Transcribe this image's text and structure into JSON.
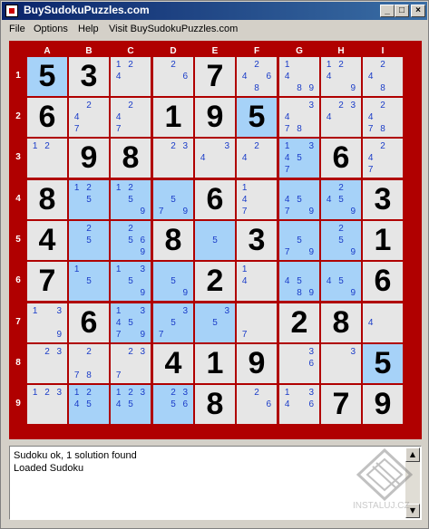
{
  "window": {
    "title": "BuySudokuPuzzles.com"
  },
  "title_buttons": {
    "minimize": "_",
    "maximize": "□",
    "close": "×"
  },
  "menu": [
    "File",
    "Options",
    "Help",
    "Visit BuySudokuPuzzles.com"
  ],
  "columns": [
    "A",
    "B",
    "C",
    "D",
    "E",
    "F",
    "G",
    "H",
    "I"
  ],
  "rows": [
    "1",
    "2",
    "3",
    "4",
    "5",
    "6",
    "7",
    "8",
    "9"
  ],
  "grid": [
    [
      {
        "v": "5",
        "hl": true
      },
      {
        "v": "3"
      },
      {
        "c": [
          "1",
          "2",
          "",
          "4"
        ]
      },
      {
        "c": [
          "",
          "2",
          "",
          "",
          "",
          "6"
        ]
      },
      {
        "v": "7"
      },
      {
        "c": [
          "",
          "2",
          "",
          "4",
          "",
          "6",
          "",
          "8"
        ]
      },
      {
        "c": [
          "1",
          "",
          "",
          "4",
          "",
          "",
          "",
          "8",
          "9"
        ]
      },
      {
        "c": [
          "1",
          "2",
          "",
          "4",
          "",
          "",
          "",
          "",
          "9"
        ]
      },
      {
        "c": [
          "",
          "2",
          "",
          "4",
          "",
          "",
          "",
          "8"
        ]
      }
    ],
    [
      {
        "v": "6"
      },
      {
        "c": [
          "",
          "2",
          "",
          "4",
          "",
          "",
          "7"
        ]
      },
      {
        "c": [
          "",
          "2",
          "",
          "4",
          "",
          "",
          "7"
        ]
      },
      {
        "v": "1"
      },
      {
        "v": "9"
      },
      {
        "v": "5",
        "hl": true
      },
      {
        "c": [
          "",
          "",
          "3",
          "4",
          "",
          "",
          "7",
          "8"
        ]
      },
      {
        "c": [
          "",
          "2",
          "3",
          "4"
        ]
      },
      {
        "c": [
          "",
          "2",
          "",
          "4",
          "",
          "",
          "7",
          "8"
        ]
      }
    ],
    [
      {
        "c": [
          "1",
          "2"
        ]
      },
      {
        "v": "9"
      },
      {
        "v": "8"
      },
      {
        "c": [
          "",
          "2",
          "3"
        ]
      },
      {
        "c": [
          "",
          "",
          "3",
          "4"
        ]
      },
      {
        "c": [
          "",
          "2",
          "",
          "4"
        ]
      },
      {
        "c": [
          "1",
          "",
          "3",
          "4",
          "5",
          "",
          "7"
        ],
        "hl": true
      },
      {
        "v": "6"
      },
      {
        "c": [
          "",
          "2",
          "",
          "4",
          "",
          "",
          "7"
        ]
      }
    ],
    [
      {
        "v": "8"
      },
      {
        "c": [
          "1",
          "2",
          "",
          "",
          "5"
        ],
        "hl": true
      },
      {
        "c": [
          "1",
          "2",
          "",
          "",
          "5",
          "",
          "",
          "",
          "9"
        ],
        "hl": true
      },
      {
        "c": [
          "",
          "",
          "",
          "",
          "5",
          "",
          "7",
          "",
          "9"
        ],
        "hl": true
      },
      {
        "v": "6"
      },
      {
        "c": [
          "1",
          "",
          "",
          "4",
          "",
          "",
          "7"
        ]
      },
      {
        "c": [
          "",
          "",
          "",
          "4",
          "5",
          "",
          "7",
          "",
          "9"
        ],
        "hl": true
      },
      {
        "c": [
          "",
          "2",
          "",
          "4",
          "5",
          "",
          "",
          "",
          "9"
        ],
        "hl": true
      },
      {
        "v": "3"
      }
    ],
    [
      {
        "v": "4"
      },
      {
        "c": [
          "",
          "2",
          "",
          "",
          "5"
        ],
        "hl": true
      },
      {
        "c": [
          "",
          "2",
          "",
          "",
          "5",
          "6",
          "",
          "",
          "9"
        ],
        "hl": true
      },
      {
        "v": "8"
      },
      {
        "c": [
          "",
          "",
          "",
          "",
          "5"
        ],
        "hl": true
      },
      {
        "v": "3"
      },
      {
        "c": [
          "",
          "",
          "",
          "",
          "5",
          "",
          "7",
          "",
          "9"
        ],
        "hl": true
      },
      {
        "c": [
          "",
          "2",
          "",
          "",
          "5",
          "",
          "",
          "",
          "9"
        ],
        "hl": true
      },
      {
        "v": "1"
      }
    ],
    [
      {
        "v": "7"
      },
      {
        "c": [
          "1",
          "",
          "",
          "",
          "5"
        ],
        "hl": true
      },
      {
        "c": [
          "1",
          "",
          "3",
          "",
          "5",
          "",
          "",
          "",
          "9"
        ],
        "hl": true
      },
      {
        "c": [
          "",
          "",
          "",
          "",
          "5",
          "",
          "",
          "",
          "9"
        ],
        "hl": true
      },
      {
        "v": "2"
      },
      {
        "c": [
          "1",
          "",
          "",
          "4"
        ]
      },
      {
        "c": [
          "",
          "",
          "",
          "4",
          "5",
          "",
          "",
          "8",
          "9"
        ],
        "hl": true
      },
      {
        "c": [
          "",
          "",
          "",
          "4",
          "5",
          "",
          "",
          "",
          "9"
        ],
        "hl": true
      },
      {
        "v": "6"
      }
    ],
    [
      {
        "c": [
          "1",
          "",
          "3",
          "",
          "",
          "",
          "",
          "",
          "9"
        ]
      },
      {
        "v": "6"
      },
      {
        "c": [
          "1",
          "",
          "3",
          "4",
          "5",
          "",
          "7",
          "",
          "9"
        ],
        "hl": true
      },
      {
        "c": [
          "",
          "",
          "3",
          "",
          "5",
          "",
          "7"
        ],
        "hl": true
      },
      {
        "c": [
          "",
          "",
          "3",
          "",
          "5"
        ],
        "hl": true
      },
      {
        "c": [
          "",
          "",
          "",
          "",
          "",
          "",
          "7"
        ]
      },
      {
        "v": "2"
      },
      {
        "v": "8"
      },
      {
        "c": [
          "",
          "",
          "",
          "4"
        ]
      }
    ],
    [
      {
        "c": [
          "",
          "2",
          "3"
        ]
      },
      {
        "c": [
          "",
          "2",
          "",
          "",
          "",
          "",
          "7",
          "8"
        ]
      },
      {
        "c": [
          "",
          "2",
          "3",
          "",
          "",
          "",
          "7"
        ]
      },
      {
        "v": "4"
      },
      {
        "v": "1"
      },
      {
        "v": "9"
      },
      {
        "c": [
          "",
          "",
          "3",
          "",
          "",
          "6"
        ]
      },
      {
        "c": [
          "",
          "",
          "3"
        ]
      },
      {
        "v": "5",
        "hl": true
      }
    ],
    [
      {
        "c": [
          "1",
          "2",
          "3"
        ]
      },
      {
        "c": [
          "1",
          "2",
          "",
          "4",
          "5"
        ],
        "hl": true
      },
      {
        "c": [
          "1",
          "2",
          "3",
          "4",
          "5"
        ],
        "hl": true
      },
      {
        "c": [
          "",
          "2",
          "3",
          "",
          "5",
          "6"
        ],
        "hl": true
      },
      {
        "v": "8"
      },
      {
        "c": [
          "",
          "2",
          "",
          "",
          "",
          "6"
        ]
      },
      {
        "c": [
          "1",
          "",
          "3",
          "4",
          "",
          "6"
        ]
      },
      {
        "v": "7"
      },
      {
        "v": "9"
      }
    ]
  ],
  "log": [
    "Sudoku ok, 1 solution found",
    "Loaded Sudoku"
  ],
  "watermark": "INSTALUJ.CZ",
  "colors": {
    "board_red": "#b00000",
    "cell_bg": "#e6e6e6",
    "highlight": "#a6d2f8",
    "candidate": "#1a3cc8"
  }
}
